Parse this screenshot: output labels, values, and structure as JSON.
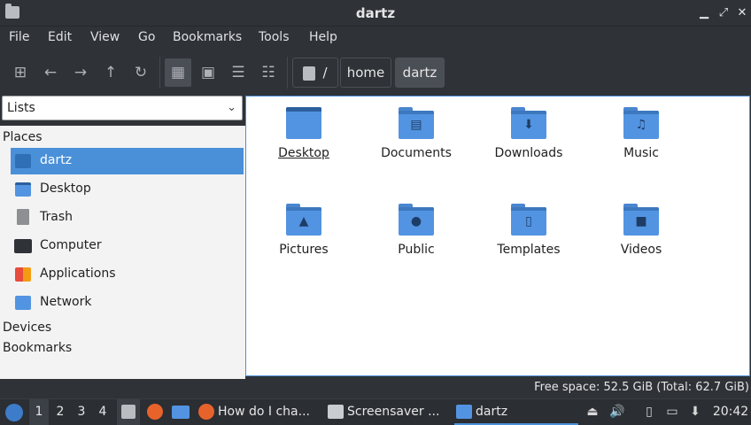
{
  "window": {
    "title": "dartz"
  },
  "menu": [
    "File",
    "Edit",
    "View",
    "Go",
    "Bookmarks",
    "Tools",
    "Help"
  ],
  "path": {
    "root": "/",
    "crumbs": [
      "home",
      "dartz"
    ]
  },
  "sidebar": {
    "mode": "Lists",
    "places_label": "Places",
    "places": [
      {
        "label": "dartz",
        "icon": "home-folder-icon"
      },
      {
        "label": "Desktop",
        "icon": "desktop-icon"
      },
      {
        "label": "Trash",
        "icon": "trash-icon"
      },
      {
        "label": "Computer",
        "icon": "computer-icon"
      },
      {
        "label": "Applications",
        "icon": "applications-icon"
      },
      {
        "label": "Network",
        "icon": "network-icon"
      }
    ],
    "devices_label": "Devices",
    "bookmarks_label": "Bookmarks"
  },
  "files": [
    {
      "name": "Desktop"
    },
    {
      "name": "Documents"
    },
    {
      "name": "Downloads"
    },
    {
      "name": "Music"
    },
    {
      "name": "Pictures"
    },
    {
      "name": "Public"
    },
    {
      "name": "Templates"
    },
    {
      "name": "Videos"
    }
  ],
  "status": "Free space: 52.5 GiB (Total: 62.7 GiB)",
  "taskbar": {
    "workspaces": [
      "1",
      "2",
      "3",
      "4"
    ],
    "tasks": [
      "How do I cha...",
      "Screensaver ...",
      "dartz"
    ],
    "clock": "20:42"
  },
  "colors": {
    "accent": "#4a90d9",
    "folder": "#5294e2"
  }
}
